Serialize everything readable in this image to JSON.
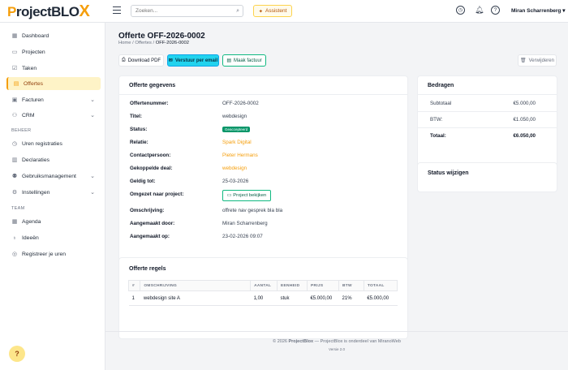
{
  "brand": {
    "name_prefix": "Project",
    "name_suffix": "BLO",
    "name_x": "X"
  },
  "topbar": {
    "search_placeholder": "Zoeken...",
    "assistant_label": "Assistent",
    "user_name": "Miran Scharrenberg",
    "user_caret": "▾"
  },
  "sidebar": {
    "items": [
      {
        "label": "Dashboard"
      },
      {
        "label": "Projecten"
      },
      {
        "label": "Taken"
      },
      {
        "label": "Offertes"
      },
      {
        "label": "Facturen"
      },
      {
        "label": "CRM"
      }
    ],
    "section_beheer": "BEHEER",
    "beheer_items": [
      {
        "label": "Uren registraties"
      },
      {
        "label": "Declaraties"
      },
      {
        "label": "Gebruiksmanagement"
      },
      {
        "label": "Instellingen"
      }
    ],
    "section_team": "TEAM",
    "team_items": [
      {
        "label": "Agenda"
      },
      {
        "label": "Ideeën"
      },
      {
        "label": "Registreer je uren"
      }
    ],
    "help_label": "?"
  },
  "page": {
    "title": "Offerte OFF-2026-0002",
    "breadcrumb": [
      "Home",
      "Offertes",
      "OFF-2026-0002"
    ],
    "breadcrumb_sep": "/"
  },
  "actions": {
    "download_pdf": "Download PDF",
    "send_email": "Verstuur per email",
    "make_invoice": "Maak factuur",
    "delete": "Verwijderen"
  },
  "details": {
    "title": "Offerte gegevens",
    "rows": [
      {
        "label": "Offertenummer:",
        "value": "OFF-2026-0002"
      },
      {
        "label": "Titel:",
        "value": "webdesign"
      },
      {
        "label": "Status:",
        "value": "Geaccepteerd"
      },
      {
        "label": "Relatie:",
        "value": "Spark Digital"
      },
      {
        "label": "Contactpersoon:",
        "value": "Pieter Hermans"
      },
      {
        "label": "Gekoppelde deal:",
        "value": "webdesign"
      },
      {
        "label": "Geldig tot:",
        "value": "25-03-2026"
      },
      {
        "label": "Omgezet naar project:",
        "value": "Project bekijken"
      },
      {
        "label": "Omschrijving:",
        "value": "offrete nav gesprek bla bla"
      },
      {
        "label": "Aangemaakt door:",
        "value": "Miran Scharrenberg"
      },
      {
        "label": "Aangemaakt op:",
        "value": "23-02-2026 09:07"
      }
    ]
  },
  "amounts": {
    "title": "Bedragen",
    "subtotal_label": "Subtotaal",
    "subtotal_value": "€5.000,00",
    "btw_label": "BTW:",
    "btw_value": "€1.050,00",
    "total_label": "Totaal:",
    "total_value": "€6.050,00"
  },
  "status_change": {
    "title": "Status wijzigen"
  },
  "lines": {
    "title": "Offerte regels",
    "headers": [
      "#",
      "OMSCHRIJVING",
      "AANTAL",
      "EENHEID",
      "PRIJS",
      "BTW",
      "TOTAAL"
    ],
    "rows": [
      [
        "1",
        "webdesign site A",
        "1,00",
        "stuk",
        "€5.000,00",
        "21%",
        "€5.000,00"
      ]
    ]
  },
  "footer": {
    "text_prefix": "© 2026 ",
    "brand": "ProjectBlox",
    "text_suffix": " — ProjectBlox is onderdeel van MiranoWeb",
    "version": "Versie 2.0"
  },
  "colors": {
    "accent": "#f59e0b",
    "success": "#059669",
    "cyan": "#22d3ee"
  },
  "icons": {
    "topbar": [
      "menu-icon",
      "search-icon",
      "sparkle-icon",
      "clock-icon",
      "bell-icon",
      "help-icon"
    ],
    "sidebar": [
      "dashboard-icon",
      "folder-icon",
      "checkbox-icon",
      "document-icon",
      "invoice-icon",
      "people-icon",
      "time-icon",
      "receipt-icon",
      "users-icon",
      "gear-icon",
      "calendar-icon",
      "lightbulb-icon",
      "user-clock-icon"
    ]
  }
}
